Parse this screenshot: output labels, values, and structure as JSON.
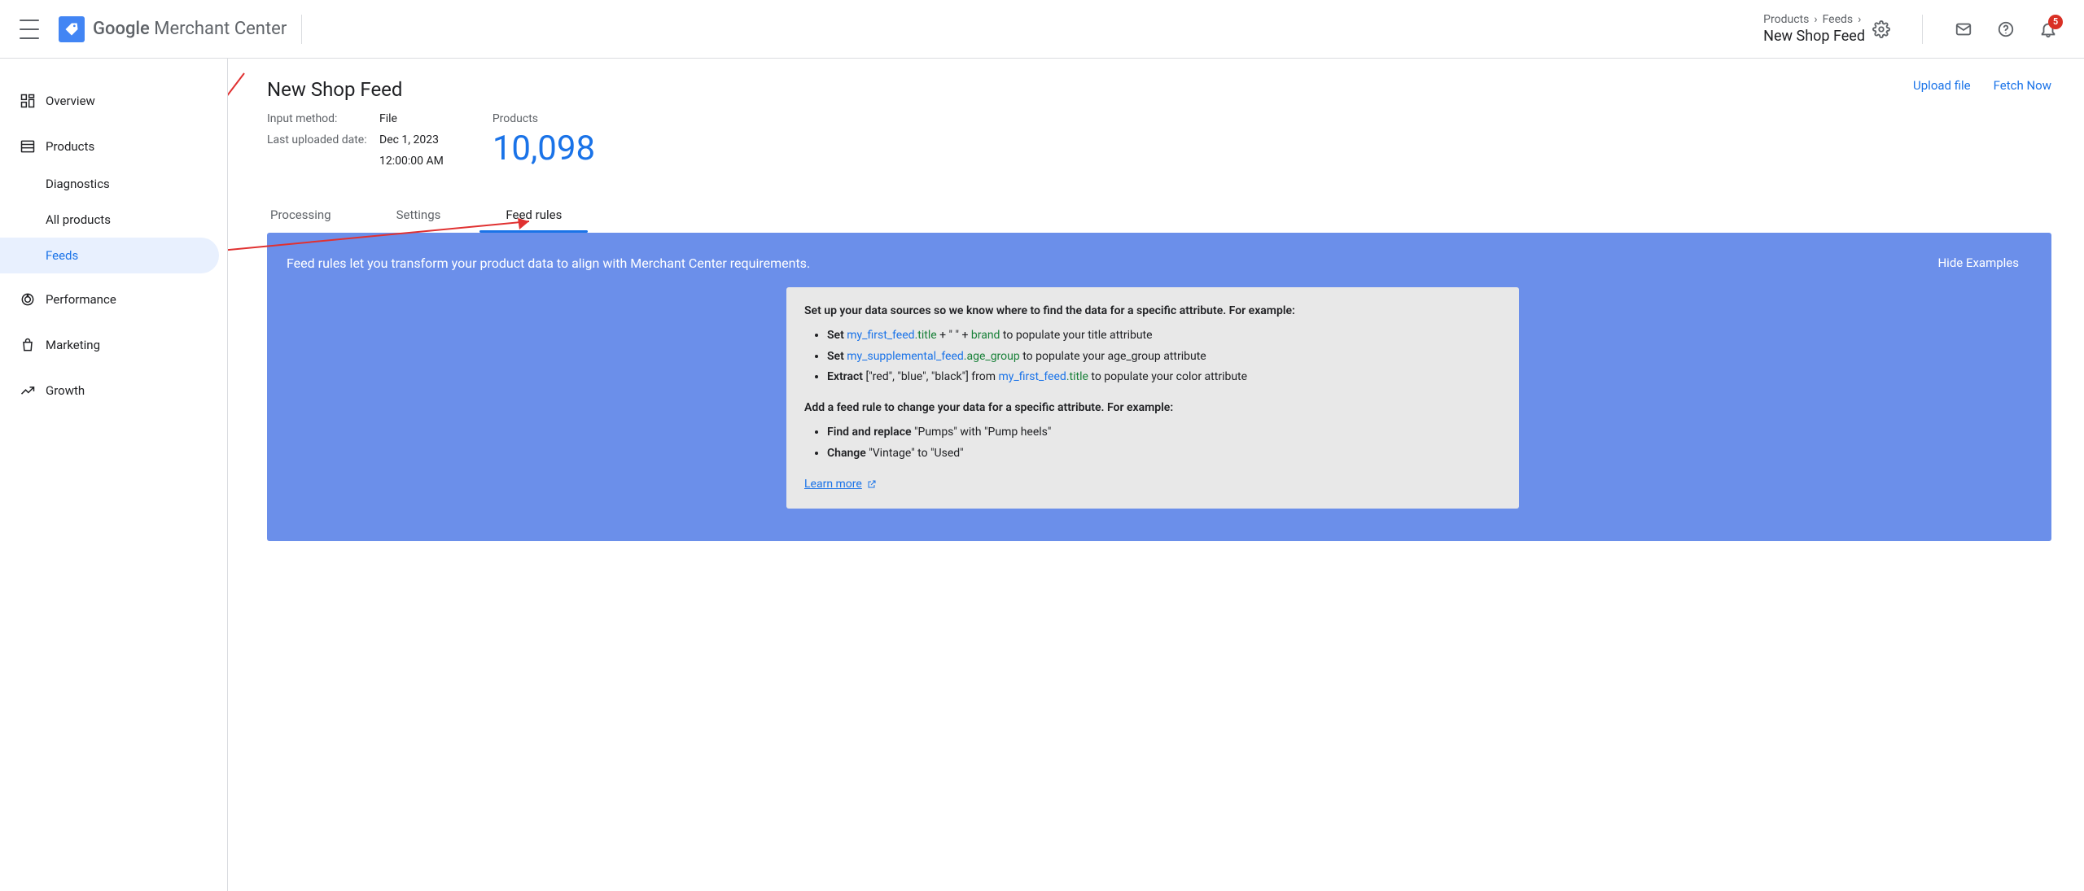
{
  "header": {
    "logo_primary": "Google",
    "logo_secondary": "Merchant Center",
    "breadcrumb": [
      "Products",
      "Feeds"
    ],
    "breadcrumb_title": "New Shop Feed",
    "notification_count": "5"
  },
  "sidebar": {
    "items": [
      {
        "label": "Overview",
        "icon": "dashboard"
      },
      {
        "label": "Products",
        "icon": "list",
        "children": [
          {
            "label": "Diagnostics"
          },
          {
            "label": "All products"
          },
          {
            "label": "Feeds",
            "active": true
          }
        ]
      },
      {
        "label": "Performance",
        "icon": "donut"
      },
      {
        "label": "Marketing",
        "icon": "bag"
      },
      {
        "label": "Growth",
        "icon": "trend"
      }
    ]
  },
  "page": {
    "title": "New Shop Feed",
    "input_method_label": "Input method:",
    "input_method_value": "File",
    "last_uploaded_label": "Last uploaded date:",
    "last_uploaded_date": "Dec 1, 2023",
    "last_uploaded_time": "12:00:00 AM",
    "products_label": "Products",
    "products_count": "10,098",
    "actions": {
      "upload": "Upload file",
      "fetch": "Fetch Now"
    }
  },
  "tabs": [
    {
      "label": "Processing"
    },
    {
      "label": "Settings"
    },
    {
      "label": "Feed rules",
      "active": true
    }
  ],
  "panel": {
    "intro": "Feed rules let you transform your product data to align with Merchant Center requirements.",
    "hide_examples": "Hide Examples",
    "heading1": "Set up your data sources so we know where to find the data for a specific attribute. For example:",
    "ex1_prefix": "Set",
    "ex1_feed": "my_first_feed",
    "ex1_attr": ".title",
    "ex1_mid": " + \" \" + ",
    "ex1_brand": "brand",
    "ex1_suffix": " to populate your title attribute",
    "ex2_prefix": "Set",
    "ex2_feed": "my_supplemental_feed",
    "ex2_attr": ".age_group",
    "ex2_suffix": " to populate your age_group attribute",
    "ex3_prefix": "Extract",
    "ex3_list": " [\"red\", \"blue\", \"black\"] from ",
    "ex3_feed": "my_first_feed",
    "ex3_attr": ".title",
    "ex3_suffix": " to populate your color attribute",
    "heading2": "Add a feed rule to change your data for a specific attribute. For example:",
    "ex4_prefix": "Find and replace",
    "ex4_body": " \"Pumps\" with \"Pump heels\"",
    "ex5_prefix": "Change",
    "ex5_body": " \"Vintage\" to \"Used\"",
    "learn_more": "Learn more"
  }
}
